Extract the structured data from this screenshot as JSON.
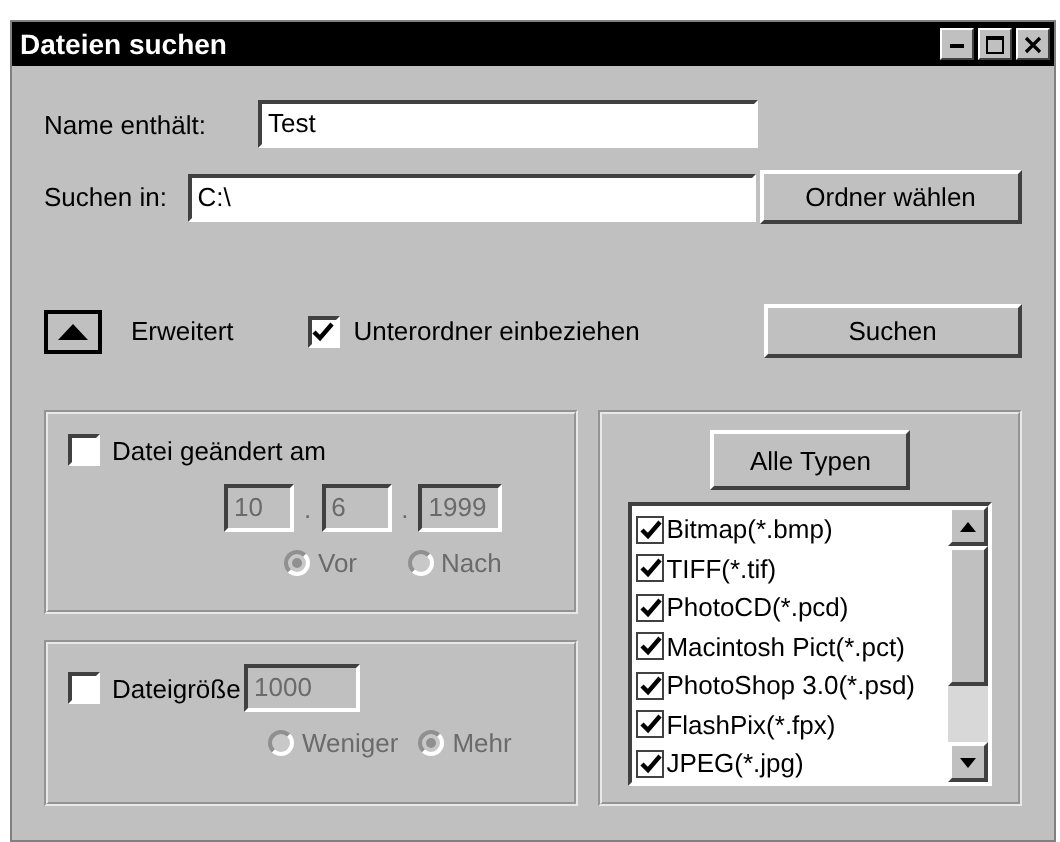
{
  "window": {
    "title": "Dateien suchen"
  },
  "name_field": {
    "label": "Name enthält:",
    "value": "Test"
  },
  "folder_field": {
    "label": "Suchen in:",
    "value": "C:\\"
  },
  "choose_folder_button": "Ordner wählen",
  "advanced": {
    "label": "Erweitert",
    "expanded": true
  },
  "subfolders": {
    "label": "Unterordner einbeziehen",
    "checked": true
  },
  "search_button": "Suchen",
  "date_group": {
    "label": "Datei geändert am",
    "checked": false,
    "day": "10",
    "month": "6",
    "year": "1999",
    "separator": ".",
    "options": [
      {
        "label": "Vor",
        "selected": true
      },
      {
        "label": "Nach",
        "selected": false
      }
    ]
  },
  "size_group": {
    "label": "Dateigröße",
    "checked": false,
    "value": "1000",
    "options": [
      {
        "label": "Weniger",
        "selected": false
      },
      {
        "label": "Mehr",
        "selected": true
      }
    ]
  },
  "types": {
    "all_button": "Alle Typen",
    "items": [
      {
        "label": "Bitmap(*.bmp)",
        "checked": true
      },
      {
        "label": "TIFF(*.tif)",
        "checked": true
      },
      {
        "label": "PhotoCD(*.pcd)",
        "checked": true
      },
      {
        "label": "Macintosh Pict(*.pct)",
        "checked": true
      },
      {
        "label": "PhotoShop 3.0(*.psd)",
        "checked": true
      },
      {
        "label": "FlashPix(*.fpx)",
        "checked": true
      },
      {
        "label": "JPEG(*.jpg)",
        "checked": true
      }
    ]
  }
}
